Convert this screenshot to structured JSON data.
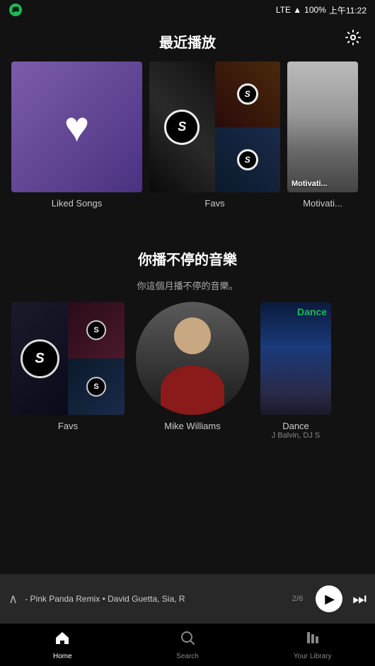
{
  "status": {
    "carrier": "Spotify",
    "network": "LTE",
    "battery": "100%",
    "time": "上午11:22"
  },
  "header": {
    "recent_plays_title": "最近播放"
  },
  "recent_section": {
    "items": [
      {
        "label": "Liked Songs",
        "type": "liked"
      },
      {
        "label": "Favs",
        "type": "favs"
      },
      {
        "label": "Motivati...",
        "type": "motivation"
      }
    ]
  },
  "featured_section": {
    "title": "你播不停的音樂",
    "subtitle": "你這個月播不停的音樂。",
    "items": [
      {
        "label": "Favs",
        "sublabel": "",
        "type": "favs-collage"
      },
      {
        "label": "Mike Williams",
        "sublabel": "",
        "type": "person",
        "shape": "circle"
      },
      {
        "label": "Dance",
        "sublabel": "J Balvin, DJ S",
        "type": "dance"
      }
    ]
  },
  "now_playing": {
    "track": "- Pink Panda Remix • David Guetta, Sia, R",
    "progress_label": "2/6"
  },
  "bottom_nav": {
    "items": [
      {
        "label": "Home",
        "icon": "home",
        "active": true
      },
      {
        "label": "Search",
        "icon": "search",
        "active": false
      },
      {
        "label": "Your Library",
        "icon": "library",
        "active": false
      }
    ]
  },
  "settings_icon": "gear"
}
